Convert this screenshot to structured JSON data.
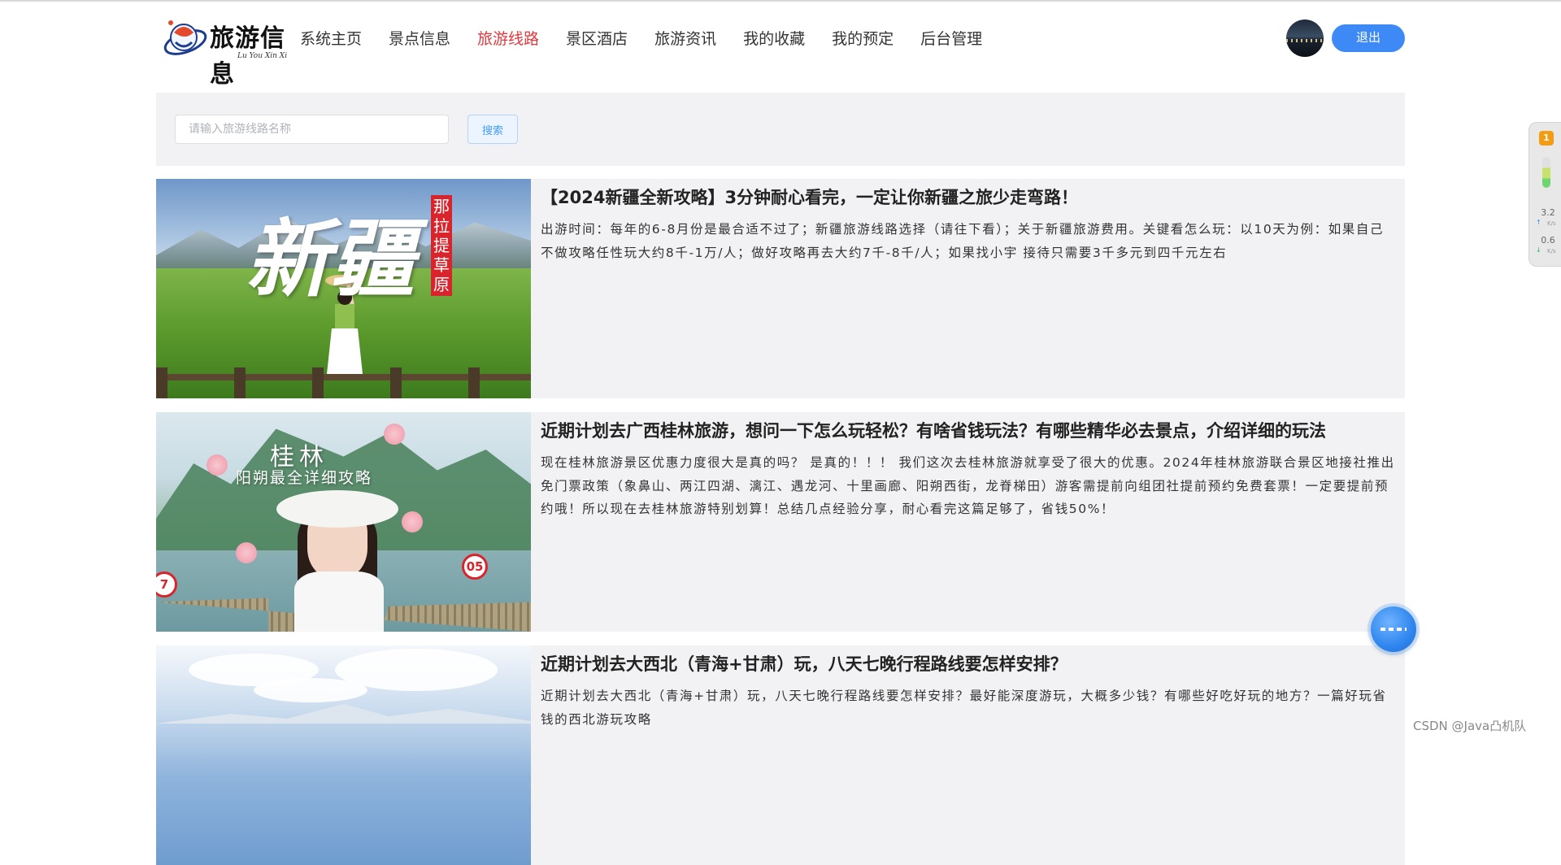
{
  "logo": {
    "text": "旅游信息",
    "subtitle": "Lu You Xin Xi"
  },
  "nav": {
    "items": [
      {
        "label": "系统主页",
        "active": false
      },
      {
        "label": "景点信息",
        "active": false
      },
      {
        "label": "旅游线路",
        "active": true
      },
      {
        "label": "景区酒店",
        "active": false
      },
      {
        "label": "旅游资讯",
        "active": false
      },
      {
        "label": "我的收藏",
        "active": false
      },
      {
        "label": "我的预定",
        "active": false
      },
      {
        "label": "后台管理",
        "active": false
      }
    ],
    "active_color": "#e0393e"
  },
  "user": {
    "logout_label": "退出",
    "accent": "#3d8af7"
  },
  "search": {
    "placeholder": "请输入旅游线路名称",
    "value": "",
    "button_label": "搜索"
  },
  "routes": [
    {
      "title": "【2024新疆全新攻略】3分钟耐心看完，一定让你新疆之旅少走弯路！",
      "description": "出游时间：每年的6-8月份是最合适不过了；新疆旅游线路选择（请往下看）；关于新疆旅游费用。关键看怎么玩：以10天为例：如果自己不做攻略任性玩大约8千-1万/人；做好攻略再去大约7千-8千/人；如果找小宇 接待只需要3千多元到四千元左右",
      "image_text": {
        "big": "新疆",
        "tag": "那拉提草原"
      }
    },
    {
      "title": "近期计划去广西桂林旅游，想问一下怎么玩轻松？有啥省钱玩法？有哪些精华必去景点，介绍详细的玩法",
      "description": "现在桂林旅游景区优惠力度很大是真的吗？ 是真的！！！ 我们这次去桂林旅游就享受了很大的优惠。2024年桂林旅游联合景区地接社推出免门票政策（象鼻山、两江四湖、漓江、遇龙河、十里画廊、阳朔西街，龙脊梯田）游客需提前向组团社提前预约免费套票！一定要提前预约哦！所以现在去桂林旅游特别划算！总结几点经验分享，耐心看完这篇足够了，省钱50%！",
      "image_text": {
        "line1": "桂林",
        "line2": "阳朔最全详细攻略",
        "sign1": "7",
        "sign2": "05"
      }
    },
    {
      "title": "近期计划去大西北（青海+甘肃）玩，八天七晚行程路线要怎样安排？",
      "description": "近期计划去大西北（青海+甘肃）玩，八天七晚行程路线要怎样安排？最好能深度游玩，大概多少钱？有哪些好吃好玩的地方？一篇好玩省钱的西北游玩攻略"
    }
  ],
  "net_widget": {
    "badge": "1",
    "up_value": "3.2",
    "down_value": "0.6",
    "unit": "K/s"
  },
  "watermark": "CSDN @Java凸机队"
}
